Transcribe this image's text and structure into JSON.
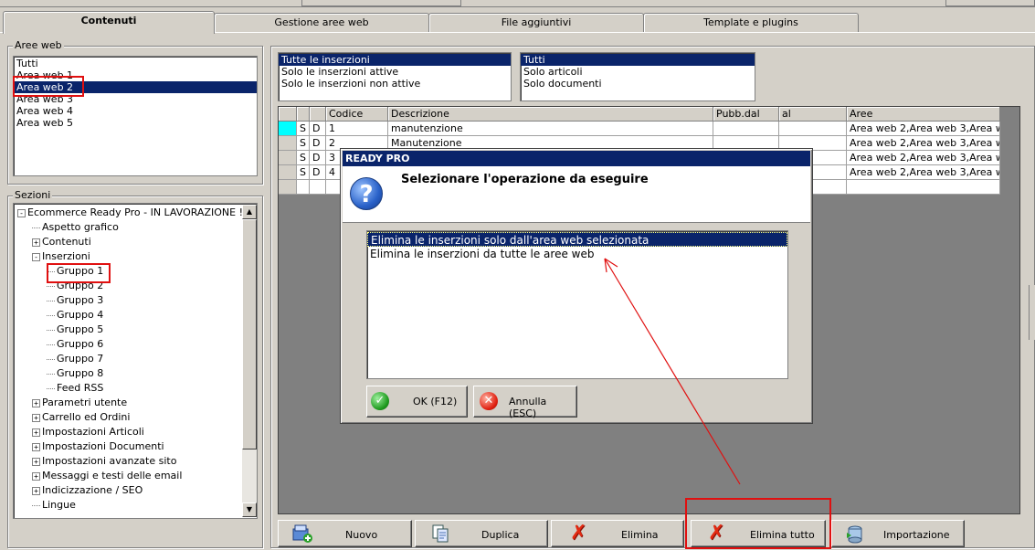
{
  "tabs": [
    {
      "label": "Contenuti",
      "active": true
    },
    {
      "label": "Gestione aree web",
      "active": false
    },
    {
      "label": "File aggiuntivi",
      "active": false
    },
    {
      "label": "Template e plugins",
      "active": false
    }
  ],
  "aree_web": {
    "legend": "Aree web",
    "items": [
      "Tutti",
      "Area web 1",
      "Area web 2",
      "Area web 3",
      "Area web 4",
      "Area web 5"
    ],
    "selected": "Area web 2"
  },
  "sezioni": {
    "legend": "Sezioni",
    "tree": [
      {
        "label": "Ecommerce Ready Pro - IN LAVORAZIONE !!",
        "level": 0,
        "expander": "-"
      },
      {
        "label": "Aspetto grafico",
        "level": 1,
        "expander": ""
      },
      {
        "label": "Contenuti",
        "level": 1,
        "expander": "+"
      },
      {
        "label": "Inserzioni",
        "level": 1,
        "expander": "-"
      },
      {
        "label": "Gruppo 1",
        "level": 2,
        "expander": ""
      },
      {
        "label": "Gruppo 2",
        "level": 2,
        "expander": ""
      },
      {
        "label": "Gruppo 3",
        "level": 2,
        "expander": ""
      },
      {
        "label": "Gruppo 4",
        "level": 2,
        "expander": ""
      },
      {
        "label": "Gruppo 5",
        "level": 2,
        "expander": ""
      },
      {
        "label": "Gruppo 6",
        "level": 2,
        "expander": ""
      },
      {
        "label": "Gruppo 7",
        "level": 2,
        "expander": ""
      },
      {
        "label": "Gruppo 8",
        "level": 2,
        "expander": ""
      },
      {
        "label": "Feed RSS",
        "level": 2,
        "expander": ""
      },
      {
        "label": "Parametri utente",
        "level": 1,
        "expander": "+"
      },
      {
        "label": "Carrello ed Ordini",
        "level": 1,
        "expander": "+"
      },
      {
        "label": "Impostazioni Articoli",
        "level": 1,
        "expander": "+"
      },
      {
        "label": "Impostazioni Documenti",
        "level": 1,
        "expander": "+"
      },
      {
        "label": "Impostazioni avanzate sito",
        "level": 1,
        "expander": "+"
      },
      {
        "label": "Messaggi e testi delle email",
        "level": 1,
        "expander": "+"
      },
      {
        "label": "Indicizzazione / SEO",
        "level": 1,
        "expander": "+"
      },
      {
        "label": "Lingue",
        "level": 1,
        "expander": ""
      }
    ],
    "selected": "Gruppo 1"
  },
  "filter_status": {
    "items": [
      "Tutte le inserzioni",
      "Solo le inserzioni attive",
      "Solo le inserzioni non attive"
    ],
    "selected": "Tutte le inserzioni"
  },
  "filter_type": {
    "items": [
      "Tutti",
      "Solo articoli",
      "Solo documenti"
    ],
    "selected": "Tutti"
  },
  "grid": {
    "columns": [
      "",
      "",
      "",
      "Codice",
      "Descrizione",
      "Pubb.dal",
      "al",
      "Aree"
    ],
    "rows": [
      [
        "",
        "S",
        "D",
        "1",
        "manutenzione",
        "",
        "",
        "Area web 2,Area web 3,Area w..."
      ],
      [
        "",
        "S",
        "D",
        "2",
        "Manutenzione",
        "",
        "",
        "Area web 2,Area web 3,Area w..."
      ],
      [
        "",
        "S",
        "D",
        "3",
        "",
        "",
        "",
        "Area web 2,Area web 3,Area w..."
      ],
      [
        "",
        "S",
        "D",
        "4",
        "",
        "",
        "",
        "Area web 2,Area web 3,Area w..."
      ]
    ]
  },
  "dialog": {
    "title": "READY PRO",
    "message": "Selezionare l'operazione da eseguire",
    "icon": "question-icon",
    "options": [
      "Elimina le inserzioni solo dall'area web selezionata",
      "Elimina le inserzioni da tutte le aree web"
    ],
    "selected_option": 0,
    "ok_label": "OK (F12)",
    "cancel_label": "Annulla (ESC)"
  },
  "toolbar": {
    "buttons": [
      {
        "label": "Nuovo",
        "icon": "new-icon"
      },
      {
        "label": "Duplica",
        "icon": "duplicate-icon"
      },
      {
        "label": "Elimina",
        "icon": "delete-icon"
      },
      {
        "label": "Elimina tutto",
        "icon": "delete-all-icon"
      },
      {
        "label": "Importazione",
        "icon": "import-icon"
      }
    ]
  },
  "colors": {
    "selection": "#0a246a",
    "annotation": "#e01010",
    "face": "#d4d0c8"
  }
}
